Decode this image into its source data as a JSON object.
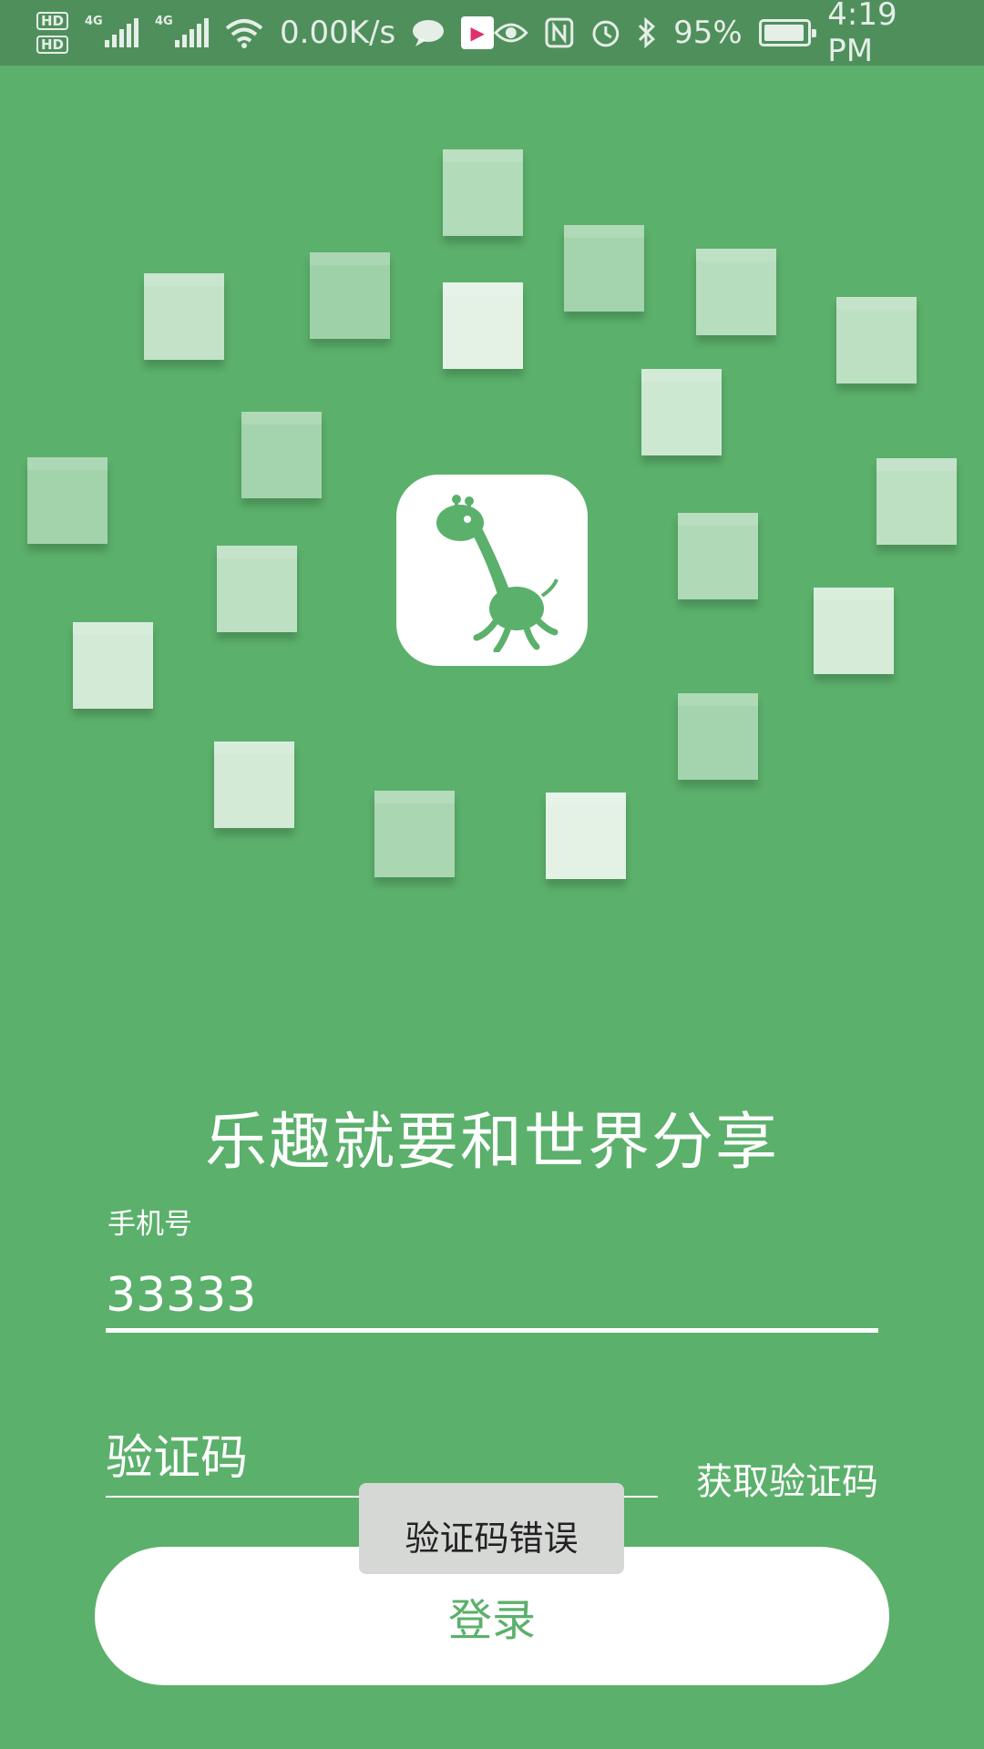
{
  "status_bar": {
    "hd1": "HD",
    "hd2": "HD",
    "net1": "4G",
    "net2": "4G",
    "speed": "0.00K/s",
    "battery": "95%",
    "time": "4:19 PM",
    "icons": [
      "hd-icon",
      "signal-icon",
      "wifi-icon",
      "chat-icon",
      "youku-icon",
      "eye-icon",
      "nfc-icon",
      "alarm-icon",
      "bluetooth-icon",
      "battery-icon"
    ],
    "battery_level": 0.95
  },
  "app": {
    "logo": "giraffe-logo",
    "slogan": "乐趣就要和世界分享",
    "accent": "#5bb06b"
  },
  "form": {
    "phone_label": "手机号",
    "phone_value": "33333",
    "code_placeholder": "验证码",
    "get_code_label": "获取验证码",
    "login_label": "登录"
  },
  "toast": {
    "message": "验证码错误"
  }
}
